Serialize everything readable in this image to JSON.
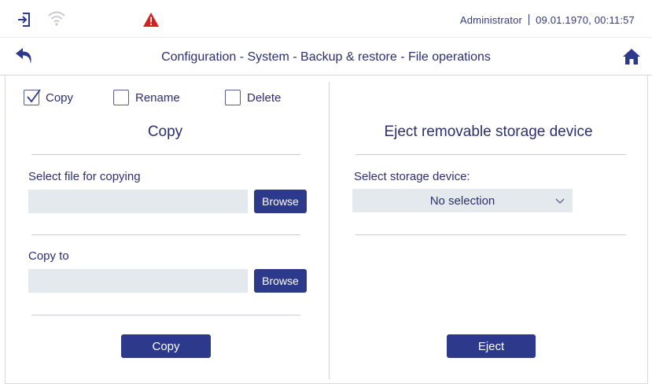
{
  "statusbar": {
    "icons": {
      "login": "login-icon",
      "wifi": "wifi-icon",
      "warning": "warning-icon"
    },
    "user": "Administrator",
    "datetime": "09.01.1970, 00:11:57",
    "warning_color": "#d62020"
  },
  "titlebar": {
    "title": "Configuration - System - Backup & restore - File operations",
    "icons": {
      "back": "back-arrow-icon",
      "home": "home-icon"
    }
  },
  "mode_options": [
    {
      "label": "Copy",
      "checked": true
    },
    {
      "label": "Rename",
      "checked": false
    },
    {
      "label": "Delete",
      "checked": false
    }
  ],
  "copy_section": {
    "title": "Copy",
    "source_label": "Select file for copying",
    "source_value": "",
    "target_label": "Copy to",
    "target_value": "",
    "browse_label": "Browse",
    "action_label": "Copy"
  },
  "eject_section": {
    "title": "Eject removable storage device",
    "device_label": "Select storage device:",
    "device_value": "No selection",
    "action_label": "Eject"
  },
  "colors": {
    "accent": "#2d3a8c",
    "text": "#2d2f6e",
    "field_bg": "#e4e9ed"
  }
}
